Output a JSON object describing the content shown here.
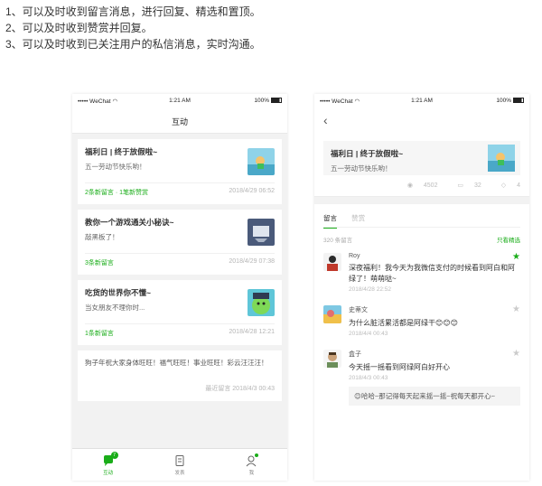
{
  "intro": [
    "1、可以及时收到留言消息，进行回复、精选和置顶。",
    "2、可以及时收到赞赏并回复。",
    "3、可以及时收到已关注用户的私信消息，实时沟通。"
  ],
  "status": {
    "carrier": "••••• WeChat",
    "time": "1:21 AM",
    "battery": "100%"
  },
  "left_phone": {
    "title": "互动",
    "cards": [
      {
        "title": "福利日 | 终于放假啦~",
        "sub": "五一劳动节快乐哟！",
        "meta": "2条新留言 · 1笔新赞赏",
        "date": "2018/4/29  06:52"
      },
      {
        "title": "教你一个游戏通关小秘诀~",
        "sub": "敲黑板了！",
        "meta": "3条新留言",
        "date": "2018/4/29  07:38"
      },
      {
        "title": "吃货的世界你不懂~",
        "sub": "当女朋友不理你时...",
        "meta": "1条新留言",
        "date": "2018/4/28  12:21"
      }
    ],
    "plain_card": {
      "text": "狗子年祝大家身体旺旺！福气旺旺！事业旺旺！彩云汪汪汪！",
      "date": "最近留言  2018/4/3  00:43"
    },
    "tabs": [
      {
        "label": "互动",
        "badge": "7"
      },
      {
        "label": "发表"
      },
      {
        "label": "我"
      }
    ]
  },
  "right_phone": {
    "article": {
      "title": "福利日 | 终于放假啦~",
      "sub": "五一劳动节快乐哟！",
      "views": "4502",
      "comments": "32",
      "likes": "4"
    },
    "tabs": {
      "comments": "留言",
      "rewards": "赞赏"
    },
    "count": "320 条留言",
    "featured": "只看精选",
    "items": [
      {
        "name": "Roy",
        "text": "深夜福利！我今天为我微信支付的时候看到阿白和阿绿了！萌萌哒~",
        "date": "2018/4/28  22:52"
      },
      {
        "name": "史蒂文",
        "text": "为什么脏活累活都是阿绿干😊😊😊",
        "date": "2018/4/4  00:43"
      },
      {
        "name": "盒子",
        "text": "今天摇一摇看到阿绿阿白好开心",
        "date": "2018/4/3  00:43",
        "reply": "😊哈哈~那记得每天起来摇一摇~祝每天都开心~"
      }
    ]
  },
  "colors": {
    "accent": "#1aad19"
  },
  "icons": [
    "wifi-icon",
    "battery-icon",
    "back-icon",
    "chat-bubble-icon",
    "document-icon",
    "person-icon",
    "eye-icon",
    "comment-icon",
    "like-icon",
    "star-icon"
  ]
}
